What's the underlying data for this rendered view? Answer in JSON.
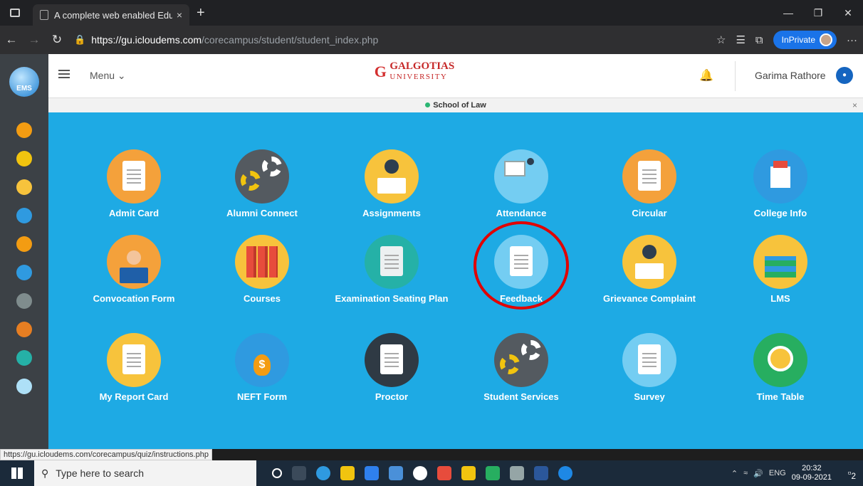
{
  "browser": {
    "tab_title": "A complete web enabled Educat",
    "tab_close": "×",
    "new_tab": "+",
    "url_host": "https://gu.icloudems.com",
    "url_path": "/corecampus/student/student_index.php",
    "inprivate_label": "InPrivate",
    "more_label": "···"
  },
  "header": {
    "menu_label": "Menu",
    "brand_line1": "GALGOTIAS",
    "brand_line2": "UNIVERSITY",
    "user_name": "Garima Rathore",
    "rail_logo": "EMS"
  },
  "banner": {
    "school": "School of Law",
    "close": "×"
  },
  "tiles": [
    {
      "label": "Admit Card",
      "icon": "admit-card-icon"
    },
    {
      "label": "Alumni Connect",
      "icon": "gears-icon"
    },
    {
      "label": "Assignments",
      "icon": "person-laptop-icon"
    },
    {
      "label": "Attendance",
      "icon": "presentation-icon"
    },
    {
      "label": "Circular",
      "icon": "clipboard-icon"
    },
    {
      "label": "College Info",
      "icon": "building-icon"
    },
    {
      "label": "Convocation Form",
      "icon": "graduate-icon"
    },
    {
      "label": "Courses",
      "icon": "books-icon"
    },
    {
      "label": "Examination Seating Plan",
      "icon": "grade-sheet-icon"
    },
    {
      "label": "Feedback",
      "icon": "feedback-form-icon"
    },
    {
      "label": "Grievance Complaint",
      "icon": "person-laptop-icon"
    },
    {
      "label": "LMS",
      "icon": "diploma-icon"
    },
    {
      "label": "My Report Card",
      "icon": "report-icon"
    },
    {
      "label": "NEFT Form",
      "icon": "money-bag-icon"
    },
    {
      "label": "Proctor",
      "icon": "document-chart-icon"
    },
    {
      "label": "Student Services",
      "icon": "gears-icon"
    },
    {
      "label": "Survey",
      "icon": "checklist-icon"
    },
    {
      "label": "Time Table",
      "icon": "alarm-clock-icon"
    }
  ],
  "status_url": "https://gu.icloudems.com/corecampus/quiz/instructions.php",
  "taskbar": {
    "search_placeholder": "Type here to search",
    "lang": "ENG",
    "time": "20:32",
    "date": "09-09-2021",
    "notif_count": "2"
  }
}
